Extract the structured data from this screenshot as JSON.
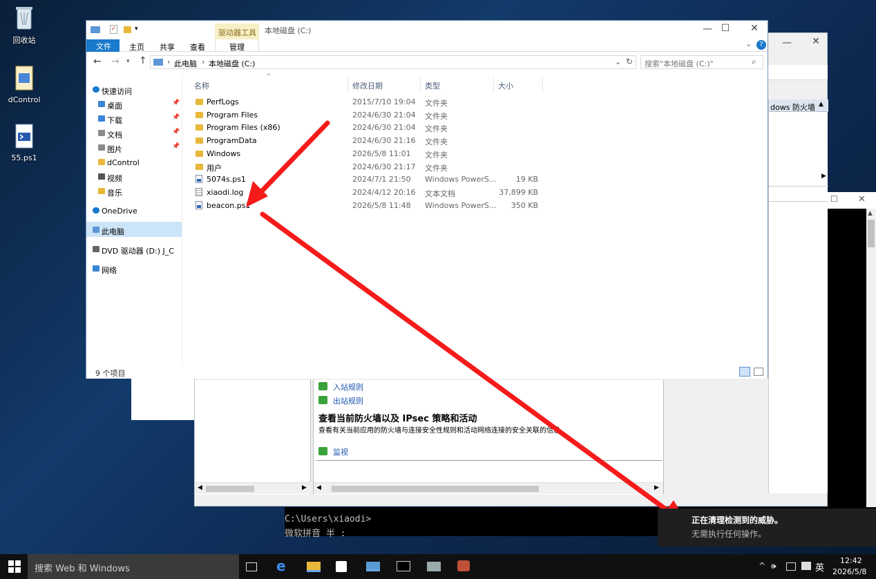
{
  "desktop": {
    "icons": [
      {
        "label": "回收站"
      },
      {
        "label": "dControl"
      },
      {
        "label": "55.ps1"
      }
    ]
  },
  "explorer": {
    "ribbon_contextual_tab": "驱动器工具",
    "title": "本地磁盘 (C:)",
    "tabs": [
      "文件",
      "主页",
      "共享",
      "查看",
      "管理"
    ],
    "breadcrumb": [
      "此电脑",
      "本地磁盘 (C:)"
    ],
    "search_placeholder": "搜索\"本地磁盘 (C:)\"",
    "columns": [
      "名称",
      "修改日期",
      "类型",
      "大小"
    ],
    "files": [
      {
        "name": "PerfLogs",
        "date": "2015/7/10 19:04",
        "type": "文件夹",
        "size": "",
        "kind": "folder"
      },
      {
        "name": "Program Files",
        "date": "2024/6/30 21:04",
        "type": "文件夹",
        "size": "",
        "kind": "folder"
      },
      {
        "name": "Program Files (x86)",
        "date": "2024/6/30 21:04",
        "type": "文件夹",
        "size": "",
        "kind": "folder"
      },
      {
        "name": "ProgramData",
        "date": "2024/6/30 21:16",
        "type": "文件夹",
        "size": "",
        "kind": "folder"
      },
      {
        "name": "Windows",
        "date": "2026/5/8 11:01",
        "type": "文件夹",
        "size": "",
        "kind": "folder"
      },
      {
        "name": "用户",
        "date": "2024/6/30 21:17",
        "type": "文件夹",
        "size": "",
        "kind": "folder"
      },
      {
        "name": "5074s.ps1",
        "date": "2024/7/1 21:50",
        "type": "Windows PowerS...",
        "size": "19 KB",
        "kind": "ps1"
      },
      {
        "name": "xiaodi.log",
        "date": "2024/4/12 20:16",
        "type": "文本文档",
        "size": "37,899 KB",
        "kind": "log"
      },
      {
        "name": "beacon.ps1",
        "date": "2026/5/8 11:48",
        "type": "Windows PowerS...",
        "size": "350 KB",
        "kind": "ps1"
      }
    ],
    "nav": [
      {
        "label": "快速访问",
        "pinned": false
      },
      {
        "label": "桌面",
        "pinned": true
      },
      {
        "label": "下载",
        "pinned": true
      },
      {
        "label": "文档",
        "pinned": true
      },
      {
        "label": "图片",
        "pinned": true
      },
      {
        "label": "dControl",
        "pinned": false
      },
      {
        "label": "视频",
        "pinned": false
      },
      {
        "label": "音乐",
        "pinned": false
      },
      {
        "label": "OneDrive",
        "pinned": false
      },
      {
        "label": "此电脑",
        "pinned": false
      },
      {
        "label": "DVD 驱动器 (D:) J_C",
        "pinned": false
      },
      {
        "label": "网络",
        "pinned": false
      }
    ],
    "status": "9 个项目"
  },
  "firewall": {
    "header_partial": "dows 防火墙",
    "links": [
      "入站规则",
      "出站规则"
    ],
    "section_title": "查看当前防火墙以及 IPsec 策略和活动",
    "section_desc": "查看有关当前应用的防火墙与连接安全性规则和活动网络连接的安全关联的信息。",
    "monitor_link": "监视"
  },
  "console": {
    "line1": "C:\\Users\\xiaodi>",
    "line2": "微软拼音 半 :"
  },
  "toast": {
    "title": "正在清理检测到的威胁。",
    "subtitle": "无需执行任何操作。"
  },
  "taskbar": {
    "search_placeholder": "搜索 Web 和 Windows",
    "ime": "英",
    "time": "12:42",
    "date": "2026/5/8"
  },
  "colors": {
    "accent": "#1979ca",
    "arrow": "#f51b1b",
    "selected": "#cce4f7"
  }
}
